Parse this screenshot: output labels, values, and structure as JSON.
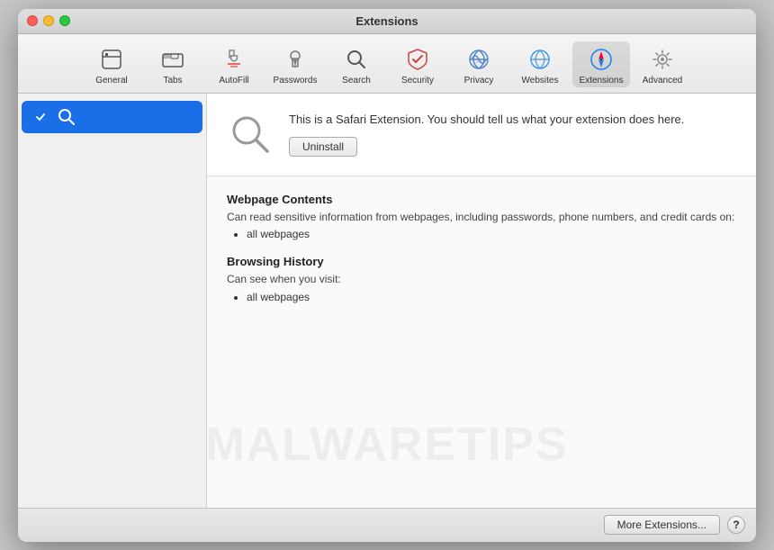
{
  "window": {
    "title": "Extensions"
  },
  "toolbar": {
    "items": [
      {
        "id": "general",
        "label": "General",
        "icon": "general"
      },
      {
        "id": "tabs",
        "label": "Tabs",
        "icon": "tabs"
      },
      {
        "id": "autofill",
        "label": "AutoFill",
        "icon": "autofill"
      },
      {
        "id": "passwords",
        "label": "Passwords",
        "icon": "passwords"
      },
      {
        "id": "search",
        "label": "Search",
        "icon": "search"
      },
      {
        "id": "security",
        "label": "Security",
        "icon": "security"
      },
      {
        "id": "privacy",
        "label": "Privacy",
        "icon": "privacy"
      },
      {
        "id": "websites",
        "label": "Websites",
        "icon": "websites"
      },
      {
        "id": "extensions",
        "label": "Extensions",
        "icon": "extensions",
        "active": true
      },
      {
        "id": "advanced",
        "label": "Advanced",
        "icon": "advanced"
      }
    ]
  },
  "sidebar": {
    "items": [
      {
        "id": "search-ext",
        "label": "Search",
        "enabled": true
      }
    ]
  },
  "extension": {
    "description": "This is a Safari Extension. You should tell us what your extension does here.",
    "uninstall_label": "Uninstall",
    "permissions": [
      {
        "title": "Webpage Contents",
        "description": "Can read sensitive information from webpages, including passwords, phone numbers, and credit cards on:",
        "items": [
          "all webpages"
        ]
      },
      {
        "title": "Browsing History",
        "description": "Can see when you visit:",
        "items": [
          "all webpages"
        ]
      }
    ]
  },
  "footer": {
    "more_extensions_label": "More Extensions...",
    "help_label": "?"
  },
  "watermark": {
    "text": "MALWARETIPS"
  }
}
